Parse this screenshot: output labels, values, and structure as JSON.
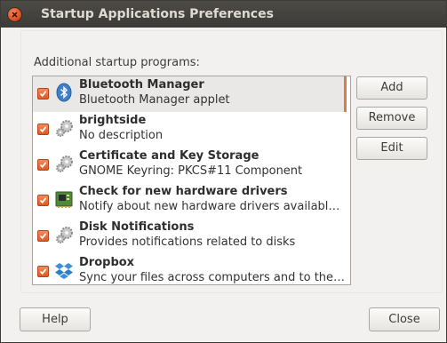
{
  "window": {
    "title": "Startup Applications Preferences"
  },
  "section": {
    "caption": "Additional startup programs:"
  },
  "programs": [
    {
      "name": "Bluetooth Manager",
      "description": "Bluetooth Manager applet",
      "checked": true,
      "icon": "bluetooth-icon",
      "selected": true
    },
    {
      "name": "brightside",
      "description": "No description",
      "checked": true,
      "icon": "gears-icon",
      "selected": false
    },
    {
      "name": "Certificate and Key Storage",
      "description": "GNOME Keyring: PKCS#11 Component",
      "checked": true,
      "icon": "gears-icon",
      "selected": false
    },
    {
      "name": "Check for new hardware drivers",
      "description": "Notify about new hardware drivers availabl…",
      "checked": true,
      "icon": "hardware-drivers-icon",
      "selected": false
    },
    {
      "name": "Disk Notifications",
      "description": "Provides notifications related to disks",
      "checked": true,
      "icon": "gears-icon",
      "selected": false
    },
    {
      "name": "Dropbox",
      "description": "Sync your files across computers and to the…",
      "checked": true,
      "icon": "dropbox-icon",
      "selected": false
    }
  ],
  "buttons": {
    "add": "Add",
    "remove": "Remove",
    "edit": "Edit",
    "help": "Help",
    "close": "Close"
  },
  "colors": {
    "accent": "#e07a48",
    "titlebar": "#3c3b37"
  }
}
